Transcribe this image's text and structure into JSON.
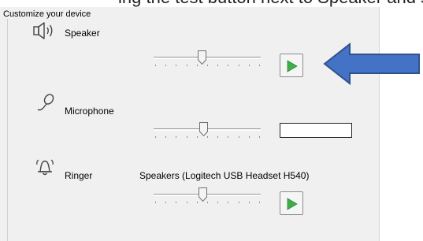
{
  "header": {
    "title": "Customize your device",
    "clipped_heading_text": "ing the test button next to Speaker and stopping the"
  },
  "speaker": {
    "label": "Speaker",
    "icon": "speaker-icon",
    "volume_fraction": 0.45
  },
  "microphone": {
    "label": "Microphone",
    "icon": "microphone-icon",
    "volume_fraction": 0.47
  },
  "ringer": {
    "label": "Ringer",
    "icon": "bell-icon",
    "device_text": "Speakers (Logitech USB Headset H540)",
    "volume_fraction": 0.46
  },
  "colors": {
    "play_green": "#3fae49",
    "arrow_fill": "#4472c4",
    "arrow_stroke": "#2f528f"
  }
}
